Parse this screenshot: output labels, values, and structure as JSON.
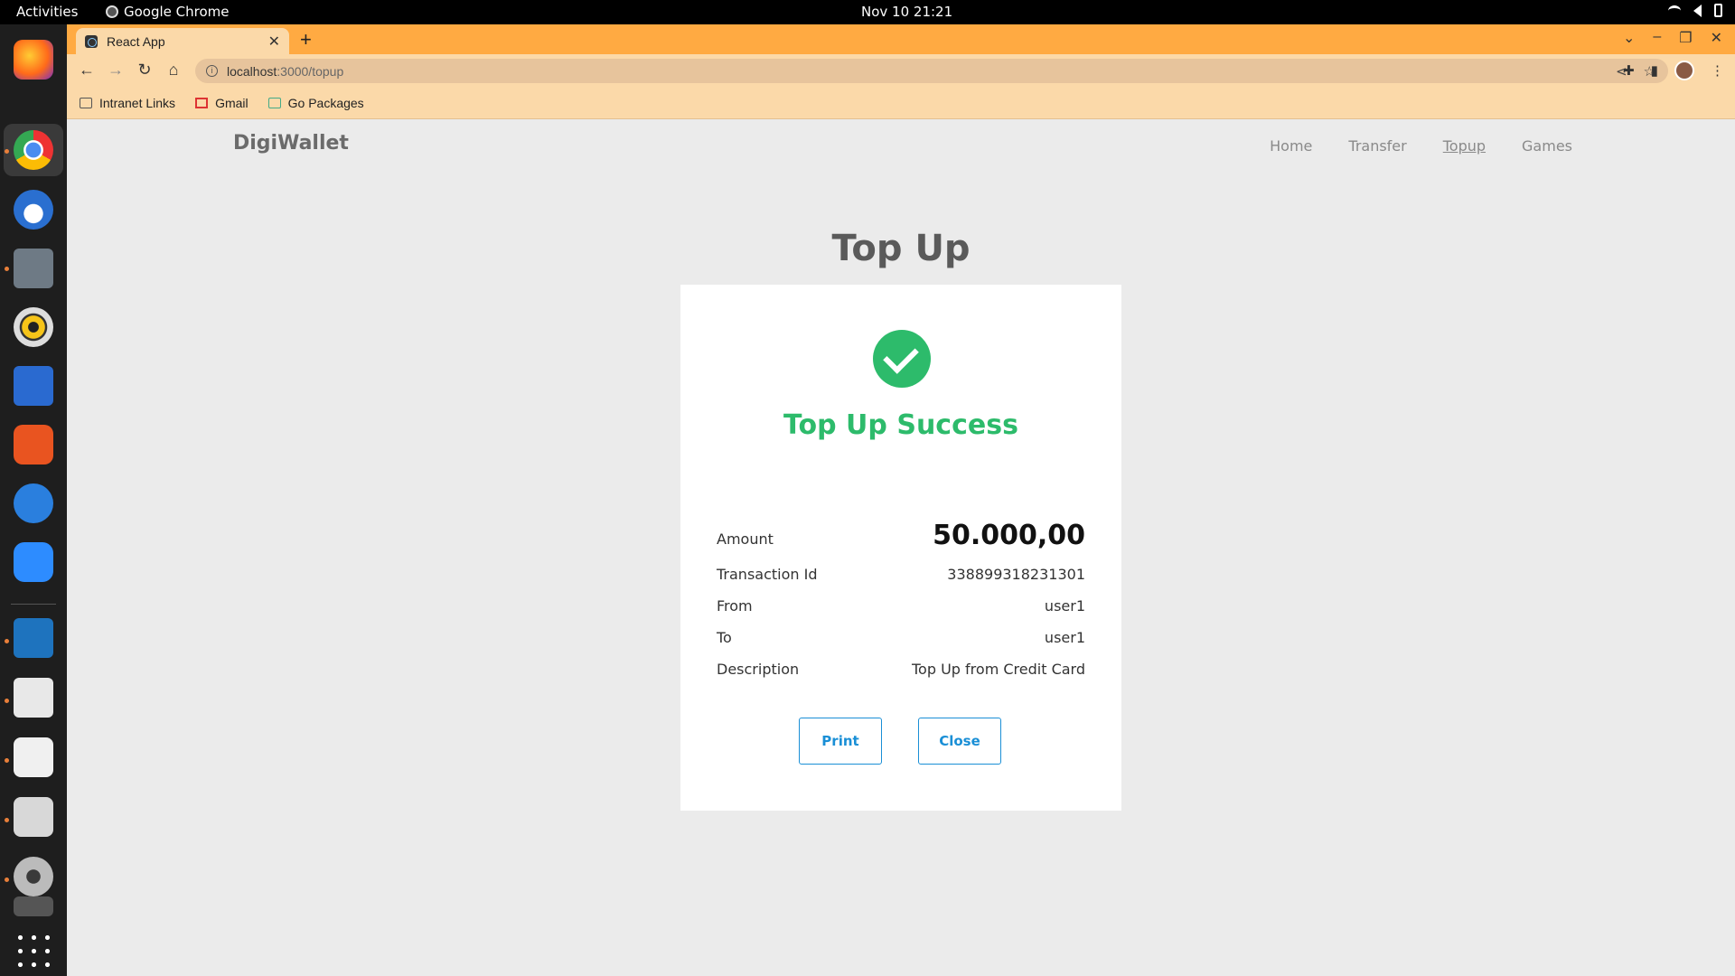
{
  "system": {
    "activities": "Activities",
    "app_name": "Google Chrome",
    "clock": "Nov 10  21:21"
  },
  "browser": {
    "tab_title": "React App",
    "url_host": "localhost",
    "url_rest": ":3000/topup",
    "bookmarks": [
      {
        "label": "Intranet Links",
        "icon": "folder-icon"
      },
      {
        "label": "Gmail",
        "icon": "gmail-icon"
      },
      {
        "label": "Go Packages",
        "icon": "go-packages-icon"
      }
    ]
  },
  "app": {
    "brand": "DigiWallet",
    "nav": [
      "Home",
      "Transfer",
      "Topup",
      "Games"
    ],
    "active_nav": "Topup",
    "heading": "Top Up",
    "success_title": "Top Up Success",
    "details": {
      "amount_label": "Amount",
      "amount_value": "50.000,00",
      "txid_label": "Transaction Id",
      "txid_value": "338899318231301",
      "from_label": "From",
      "from_value": "user1",
      "to_label": "To",
      "to_value": "user1",
      "desc_label": "Description",
      "desc_value": "Top Up from Credit Card"
    },
    "buttons": {
      "print": "Print",
      "close": "Close"
    }
  },
  "colors": {
    "success": "#2dbb6b",
    "button": "#1a8fd6",
    "chrome_tabbar": "#ffaa42"
  }
}
